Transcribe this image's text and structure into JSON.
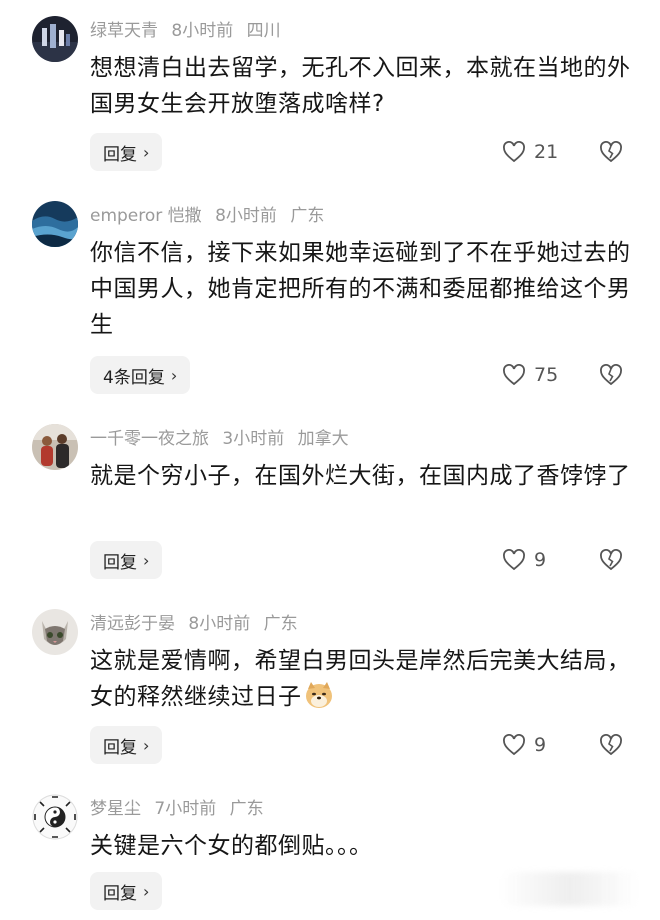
{
  "comments": [
    {
      "username": "绿草天青",
      "time": "8小时前",
      "location": "四川",
      "text": "想想清白出去留学，无孔不入回来，本就在当地的外国男女生会开放堕落成啥样?",
      "reply_label": "回复",
      "likes": "21"
    },
    {
      "username": "emperor 恺撒",
      "time": "8小时前",
      "location": "广东",
      "text": "你信不信，接下来如果她幸运碰到了不在乎她过去的中国男人，她肯定把所有的不满和委屈都推给这个男生",
      "reply_label": "4条回复",
      "likes": "75"
    },
    {
      "username": "一千零一夜之旅",
      "time": "3小时前",
      "location": "加拿大",
      "text": "就是个穷小子，在国外烂大街，在国内成了香饽饽了",
      "reply_label": "回复",
      "likes": "9"
    },
    {
      "username": "清远彭于晏",
      "time": "8小时前",
      "location": "广东",
      "text": "这就是爱情啊，希望白男回头是岸然后完美大结局，女的释然继续过日子",
      "reply_label": "回复",
      "likes": "9"
    },
    {
      "username": "梦星尘",
      "time": "7小时前",
      "location": "广东",
      "text": "关键是六个女的都倒贴。。。",
      "reply_label": "回复",
      "likes": ""
    }
  ],
  "icons": {
    "like": "heart-outline-icon",
    "dislike": "broken-heart-icon",
    "reply_chevron": "chevron-right-icon",
    "emoji": "doge-emoji-icon"
  },
  "colors": {
    "meta_text": "#9a9a9a",
    "reply_bg": "#f2f2f2",
    "icon": "#555555"
  }
}
